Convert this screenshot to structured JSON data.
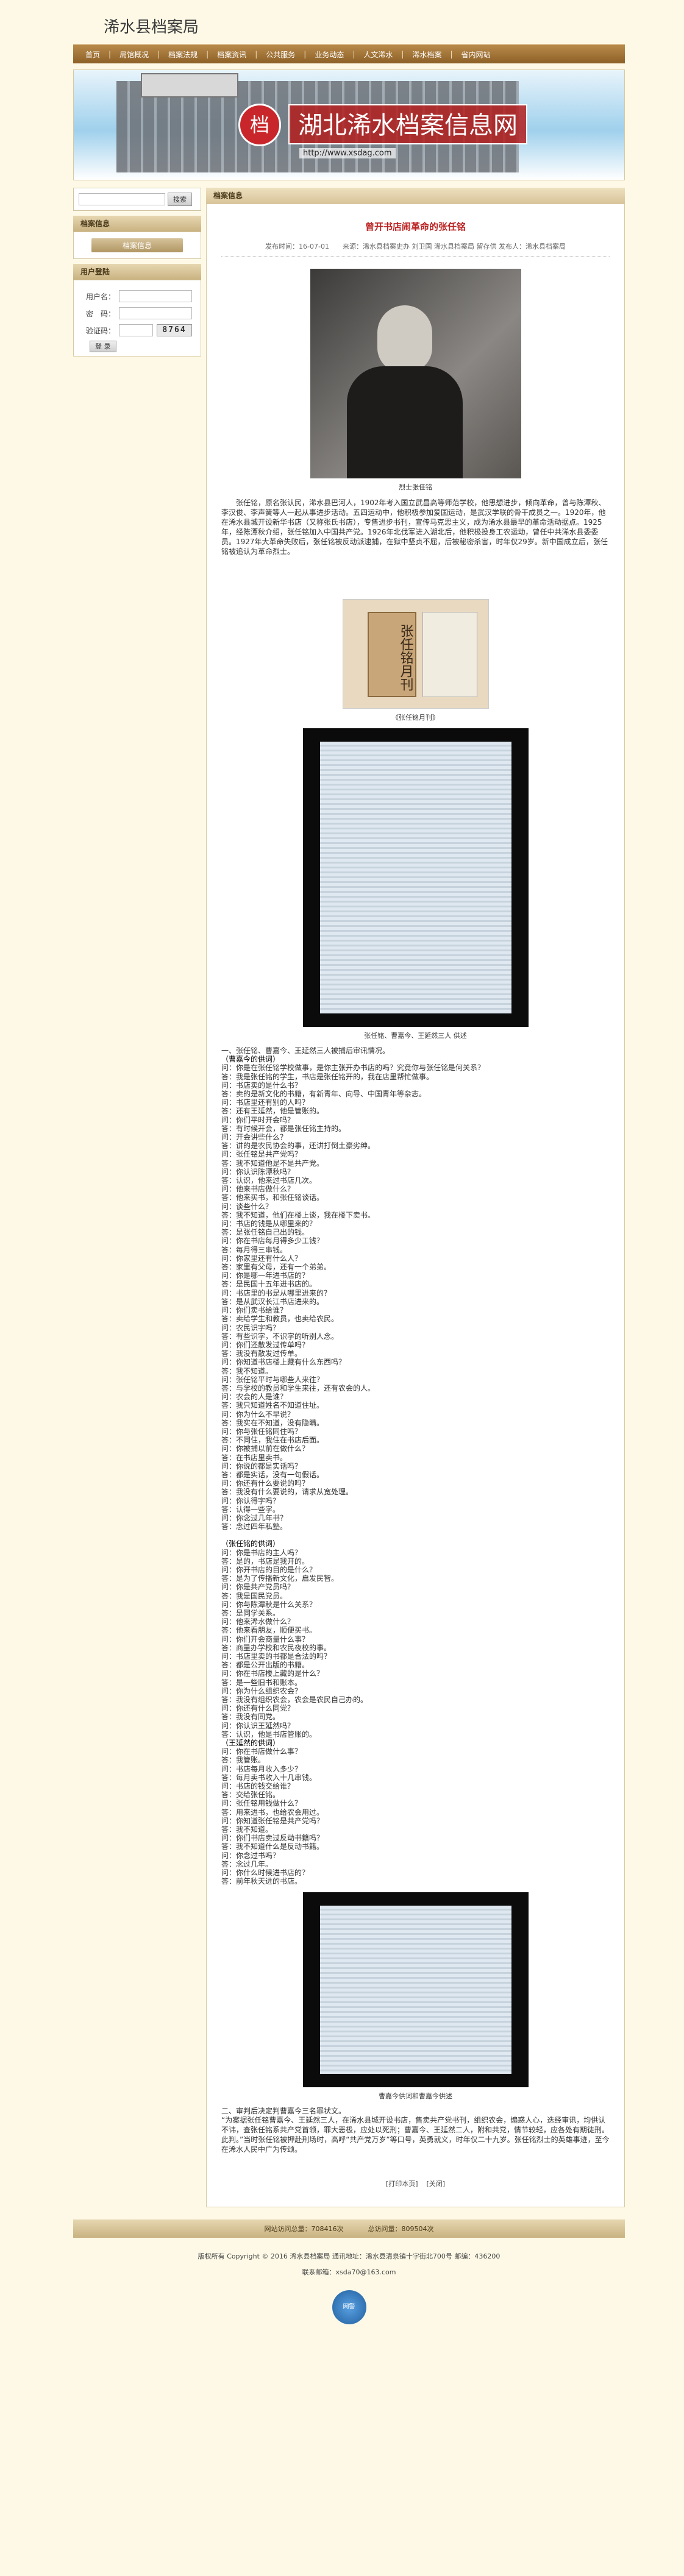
{
  "site": {
    "title": "浠水县档案局"
  },
  "nav": [
    "首页",
    "局馆概况",
    "档案法规",
    "档案资讯",
    "公共服务",
    "业务动态",
    "人文浠水",
    "浠水档案",
    "省内网站"
  ],
  "banner": {
    "logo_glyph": "档",
    "text": "湖北浠水档案信息网",
    "url": "http://www.xsdag.com"
  },
  "search": {
    "placeholder": "",
    "button": "搜索"
  },
  "left": {
    "archive_header": "档案信息",
    "archive_item": "档案信息",
    "user_header": "用户登陆",
    "username_label": "用户名：",
    "password_label": "密　码：",
    "captcha_label": "验证码：",
    "captcha_value": "8764",
    "login_button": "登 录"
  },
  "main": {
    "header": "档案信息",
    "title": "曾开书店闹革命的张任铭",
    "meta": "发布时间：16-07-01　　来源：浠水县档案史办 刘卫国 浠水县档案局 留存供 发布人：浠水县档案局",
    "caption1": "烈士张任铭",
    "intro": "张任铭，原名张认民，浠水县巴河人，1902年考入国立武昌高等师范学校，他思想进步，倾向革命，曾与陈潭秋、李汉俊、李声簧等人一起从事进步活动。五四运动中，他积极参加爱国运动，是武汉学联的骨干成员之一。1920年，他在浠水县城开设新华书店（又称张氏书店），专售进步书刊，宣传马克思主义，成为浠水县最早的革命活动据点。1925年，经陈潭秋介绍，张任铭加入中国共产党。1926年北伐军进入湖北后，他积极投身工农运动，曾任中共浠水县委委员。1927年大革命失败后，张任铭被反动派逮捕，在狱中坚贞不屈，后被秘密杀害，时年仅29岁。新中国成立后，张任铭被追认为革命烈士。",
    "caption2": "《张任铭月刊》",
    "caption3": "张任铭、曹嘉今、王延然三人 供述",
    "qa_heading": "一、张任铭、曹嘉今、王延然三人被捕后审讯情况。",
    "qa_sec1": "（曹嘉今的供词）",
    "qa1": [
      "问：你是在张任铭学校做事，是你主张开办书店的吗？究竟你与张任铭是何关系？",
      "答：我是张任铭的学生，书店是张任铭开的，我在店里帮忙做事。",
      "问：书店卖的是什么书？",
      "答：卖的是新文化的书籍，有新青年、向导、中国青年等杂志。",
      "问：书店里还有别的人吗？",
      "答：还有王延然，他是管账的。",
      "问：你们平时开会吗？",
      "答：有时候开会，都是张任铭主持的。",
      "问：开会讲些什么？",
      "答：讲的是农民协会的事，还讲打倒土豪劣绅。",
      "问：张任铭是共产党吗？",
      "答：我不知道他是不是共产党。",
      "问：你认识陈潭秋吗？",
      "答：认识，他来过书店几次。",
      "问：他来书店做什么？",
      "答：他来买书，和张任铭谈话。",
      "问：谈些什么？",
      "答：我不知道，他们在楼上谈，我在楼下卖书。",
      "问：书店的钱是从哪里来的？",
      "答：是张任铭自己出的钱。",
      "问：你在书店每月得多少工钱？",
      "答：每月得三串钱。",
      "问：你家里还有什么人？",
      "答：家里有父母，还有一个弟弟。",
      "问：你是哪一年进书店的？",
      "答：是民国十五年进书店的。",
      "问：书店里的书是从哪里进来的？",
      "答：是从武汉长江书店进来的。",
      "问：你们卖书给谁？",
      "答：卖给学生和教员，也卖给农民。",
      "问：农民识字吗？",
      "答：有些识字，不识字的听别人念。",
      "问：你们还散发过传单吗？",
      "答：我没有散发过传单。",
      "问：你知道书店楼上藏有什么东西吗？",
      "答：我不知道。",
      "问：张任铭平时与哪些人来往？",
      "答：与学校的教员和学生来往，还有农会的人。",
      "问：农会的人是谁？",
      "答：我只知道姓名不知道住址。",
      "问：你为什么不早说？",
      "答：我实在不知道，没有隐瞒。",
      "问：你与张任铭同住吗？",
      "答：不同住，我住在书店后面。",
      "问：你被捕以前在做什么？",
      "答：在书店里卖书。",
      "问：你说的都是实话吗？",
      "答：都是实话，没有一句假话。",
      "问：你还有什么要说的吗？",
      "答：我没有什么要说的，请求从宽处理。",
      "问：你认得字吗？",
      "答：认得一些字。",
      "问：你念过几年书？",
      "答：念过四年私塾。"
    ],
    "qa_sec2": "（张任铭的供词）",
    "qa2": [
      "问：你是书店的主人吗？",
      "答：是的，书店是我开的。",
      "问：你开书店的目的是什么？",
      "答：是为了传播新文化，启发民智。",
      "问：你是共产党员吗？",
      "答：我是国民党员。",
      "问：你与陈潭秋是什么关系？",
      "答：是同学关系。",
      "问：他来浠水做什么？",
      "答：他来看朋友，顺便买书。",
      "问：你们开会商量什么事？",
      "答：商量办学校和农民夜校的事。",
      "问：书店里卖的书都是合法的吗？",
      "答：都是公开出版的书籍。",
      "问：你在书店楼上藏的是什么？",
      "答：是一些旧书和账本。",
      "问：你为什么组织农会？",
      "答：我没有组织农会，农会是农民自己办的。",
      "问：你还有什么同党？",
      "答：我没有同党。",
      "问：你认识王延然吗？",
      "答：认识，他是书店管账的。"
    ],
    "qa_sec3": "（王延然的供词）",
    "qa3": [
      "问：你在书店做什么事？",
      "答：我管账。",
      "问：书店每月收入多少？",
      "答：每月卖书收入十几串钱。",
      "问：书店的钱交给谁？",
      "答：交给张任铭。",
      "问：张任铭用钱做什么？",
      "答：用来进书，也给农会用过。",
      "问：你知道张任铭是共产党吗？",
      "答：我不知道。",
      "问：你们书店卖过反动书籍吗？",
      "答：我不知道什么是反动书籍。",
      "问：你念过书吗？",
      "答：念过几年。",
      "问：你什么时候进书店的？",
      "答：前年秋天进的书店。"
    ],
    "caption4": "曹嘉今供词和曹嘉今供述",
    "summary": [
      "二、审判后决定判曹嘉今三名罪状文。",
      "“为案据张任铭曹嘉今、王延然三人，在浠水县城开设书店，售卖共产党书刊，组织农会，煽惑人心，迭经审讯，均供认不讳，查张任铭系共产党首领，罪大恶极，应处以死刑；曹嘉今、王延然二人，附和共党，情节较轻，应各处有期徒刑。此判。”当时张任铭被押赴刑场时，高呼“共产党万岁”等口号，英勇就义，时年仅二十九岁。张任铭烈士的英雄事迹，至今在浠水人民中广为传颂。"
    ],
    "print_link": "[打印本页]",
    "close_link": "[关闭]"
  },
  "footer": {
    "visits_label": "网站访问总量：",
    "visits": "708416次",
    "today_label": "总访问量：",
    "today": "809504次",
    "copyright": "版权所有 Copyright © 2016 浠水县档案局 通讯地址：浠水县清泉镇十字街北700号 邮编：436200",
    "email": "联系邮箱：xsda70@163.com",
    "badge": "网警"
  }
}
